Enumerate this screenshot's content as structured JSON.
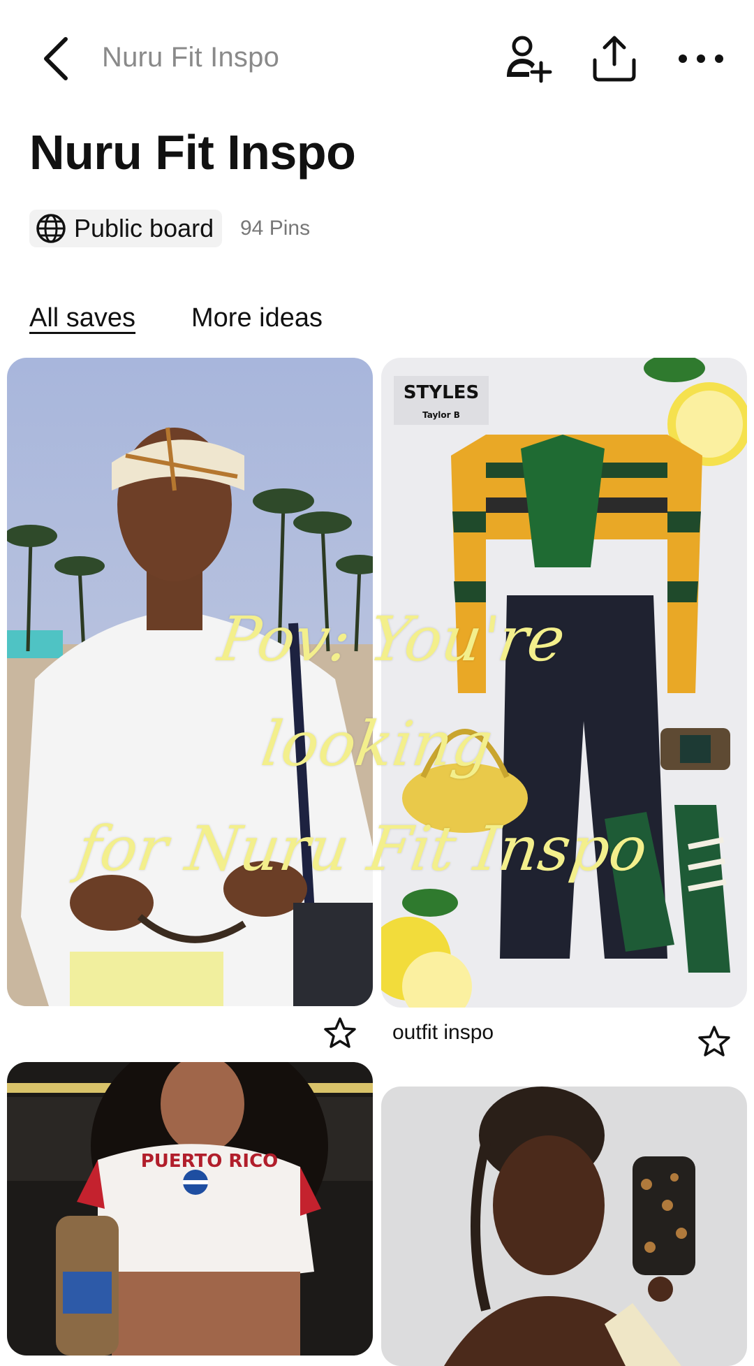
{
  "topbar": {
    "title": "Nuru Fit Inspo",
    "back_icon": "chevron-left-icon",
    "actions": [
      "add-collaborator-icon",
      "share-icon",
      "more-icon"
    ]
  },
  "board": {
    "title": "Nuru Fit Inspo",
    "visibility": "Public board",
    "visibility_icon": "globe-icon",
    "pin_count": "94 Pins"
  },
  "tabs": [
    {
      "label": "All saves",
      "active": true
    },
    {
      "label": "More ideas",
      "active": false
    }
  ],
  "pins": [
    {
      "caption": ""
    },
    {
      "caption": "outfit inspo",
      "brand_label": "STYLES",
      "brand_sub": "Taylor B"
    },
    {
      "caption": "",
      "shirt_text": "PUERTO RICO"
    },
    {
      "caption": ""
    }
  ],
  "overlay": {
    "line1": "Pov: You're looking",
    "line2": "for Nuru Fit Inspo"
  },
  "colors": {
    "overlay_text": "#f3ef8c",
    "muted_text": "#8a8a8a",
    "chip_bg": "#f2f2f2"
  }
}
